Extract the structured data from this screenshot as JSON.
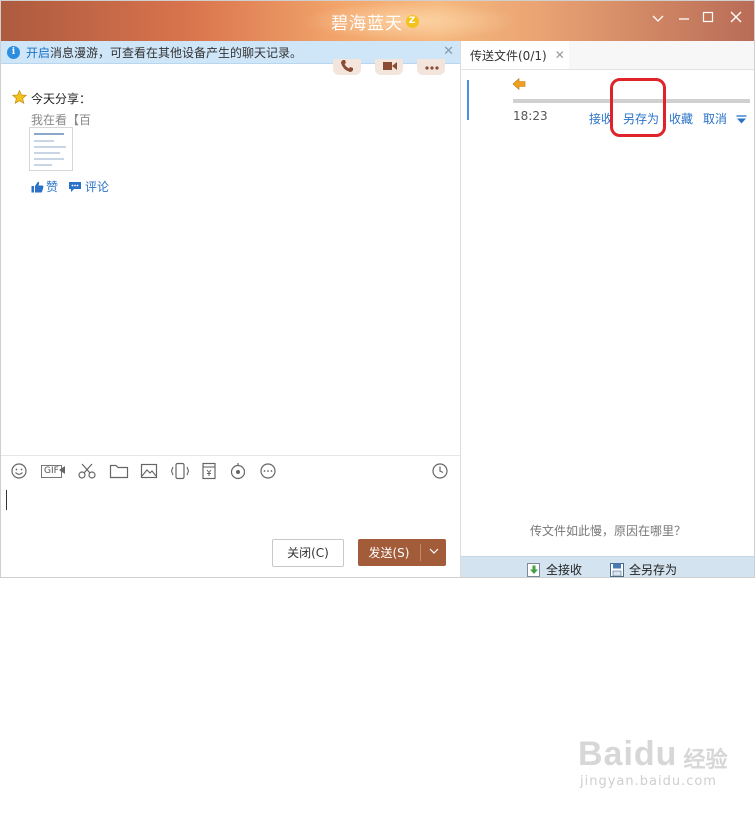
{
  "window": {
    "title": "碧海蓝天",
    "title_badge": "Z",
    "controls": {
      "minimize": "﹀",
      "restore": "—",
      "maximize": "☐",
      "close": "✕"
    }
  },
  "infobar": {
    "link": "开启",
    "text": "消息漫游，可查看在其他设备产生的聊天记录。",
    "close": "✕"
  },
  "chat": {
    "share_label": "今天分享：",
    "share_text": "我在看【百",
    "like": "赞",
    "comment": "评论"
  },
  "composer": {
    "gif": "GIF",
    "close_button": "关闭(C)",
    "send_button": "发送(S)",
    "send_dropdown": "﹀"
  },
  "file_panel": {
    "tab_label": "传送文件(0/1)",
    "tab_close": "✕",
    "time": "18:23",
    "actions": [
      "接收",
      "另存为",
      "收藏",
      "取消"
    ],
    "hint": "传文件如此慢，原因在哪里？",
    "bottom": {
      "receive_all": "全接收",
      "save_all": "全另存为"
    }
  },
  "watermark": {
    "logo": "Baidu",
    "sub": "jingyan.baidu.com",
    "cn": "经验"
  },
  "colors": {
    "accent": "#a35c3a",
    "link": "#2a72c8",
    "highlight": "#e0232b"
  }
}
